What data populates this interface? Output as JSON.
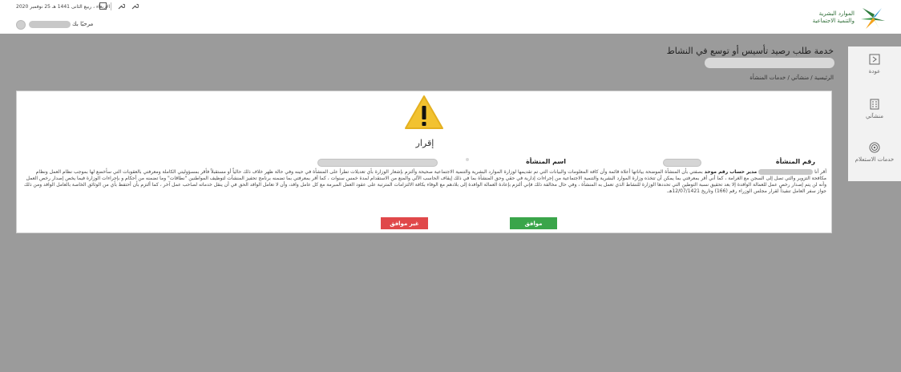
{
  "header": {
    "logo_text_line1": "الموارد البشرية",
    "logo_text_line2": "والتنمية الاجتماعية",
    "date_text": "الأربعاء ، ربيع الثانى 1441 هـ 25 نوفمبر 2020",
    "greeting": "مرحبًا بك",
    "icons": [
      "calendar-icon",
      "settings-icon",
      "tools-icon"
    ]
  },
  "sidebar": {
    "items": [
      {
        "label": "عودة",
        "icon": "back-icon"
      },
      {
        "label": "منشآتي",
        "icon": "building-icon"
      },
      {
        "label": "خدمات الاستعلام",
        "icon": "fingerprint-icon"
      }
    ]
  },
  "page": {
    "title": "خدمة طلب رصيد تأسيس أو توسع في النشاط",
    "breadcrumb": "الرئيسية / منشآتي / خدمات المنشأة"
  },
  "card": {
    "title": "إقرار",
    "field_number_label": "رقم المنشأة",
    "field_name_label": "اسم المنشأة",
    "declaration_start": "أقر أنا",
    "declaration_role": "مدير حساب رقم موحد",
    "declaration_body": "بصفتي بأن المنشأة الموضحة بياناتها أعلاه قائمة وأن كافة المعلومات والبيانات التي تم تقديمها لوزارة الموارد البشرية والتنمية الاجتماعية صحيحة وألتزم بإشعار الوزارة بأي تعديلات تطرأ على المنشأة في حينه وفي حالة ظهر خلاف ذلك حالياً أو مستقبلاً فأقر بمسؤوليتي الكاملة ومعرفتي بالعقوبات التي سأخضع لها بموجب نظام العمل ونظام مكافحة التزوير والتي تصل إلى السجن مع الغرامة ، كما أني أقر بمعرفتي بما يمكن أن تتخذه وزارة الموارد البشرية والتنمية الاجتماعية من إجراءات إدارية في حقي وحق المنشأة بما في ذلك إيقاف الحاسب الآلي والمنع من الاستقدام لمدة خمس سنوات ، كما أقر بمعرفتي بما تضمنه برنامج تحفيز المنشآت لتوظيف المواطنين \"نطاقات\" وما تضمنه من أحكام و بإجراءات الوزارة فيما يخص إصدار رخص العمل وأنه لن يتم إصدار رخص عمل للعمالة الوافدة إلا بعد تحقيق نسبة التوطين التي تحددها الوزارة للنشاط الذي تعمل به المنشأة ، وفي حال مخالفة ذلك فإني ألتزم بإعادة العمالة الوافدة إلى بلادهم مع الوفاء بكافة الالتزامات المترتبة على عقود العمل المبرمة مع كل عامل وافد، وأن لا تعامل الوافد الحق في أن ينقل خدماته لصاحب عمل آخر ، كما ألتزم بأن أحتفظ بأي من الوثائق الخاصة بالعامل الوافد ومن ذلك جواز سفر العامل تنفيذاً لقرار مجلس الوزراء رقم (166) وتاريخ 12/07/1421هـ.",
    "agree_label": "موافق",
    "disagree_label": "غير موافق"
  },
  "colors": {
    "backdrop": "#9b9b9b",
    "agree": "#3aa54a",
    "disagree": "#e0484a",
    "warning": "#f2c230"
  }
}
